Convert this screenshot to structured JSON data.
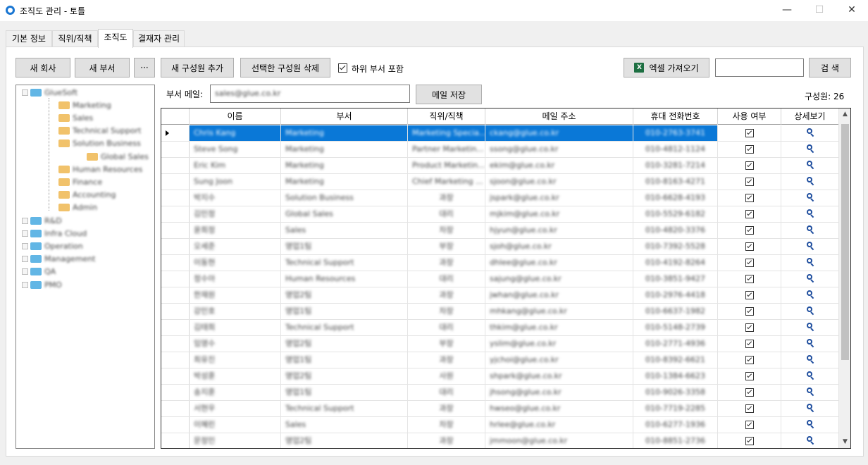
{
  "window": {
    "title": "조직도 관리 - 토틀",
    "minimize_glyph": "—",
    "maximize_glyph": "☐",
    "close_glyph": "✕"
  },
  "tabs": [
    {
      "label": "기본 정보"
    },
    {
      "label": "직위/직책"
    },
    {
      "label": "조직도"
    },
    {
      "label": "결재자 관리"
    }
  ],
  "active_tab": "조직도",
  "toolbar": {
    "new_company": "새 회사",
    "new_department": "새 부서",
    "more": "···",
    "add_member": "새 구성원 추가",
    "delete_selected": "선택한 구성원 삭제",
    "include_subdepartments": "하위 부서 포함",
    "include_subdepartments_checked": true,
    "excel_import": "엑셀 가져오기",
    "excel_icon_text": "X",
    "search_value": "",
    "search_button": "검 색"
  },
  "department_mail": {
    "label": "부서 메일:",
    "value": "sales@glue.co.kr",
    "save_button": "메일 저장"
  },
  "member_count_label": "구성원: 26",
  "tree": [
    {
      "label": "GlueSoft",
      "level": 0
    },
    {
      "label": "Marketing",
      "level": 1
    },
    {
      "label": "Sales",
      "level": 1
    },
    {
      "label": "Technical Support",
      "level": 1
    },
    {
      "label": "Solution Business",
      "level": 1
    },
    {
      "label": "Global Sales",
      "level": 2
    },
    {
      "label": "Human Resources",
      "level": 1
    },
    {
      "label": "Finance",
      "level": 1
    },
    {
      "label": "Accounting",
      "level": 1
    },
    {
      "label": "Admin",
      "level": 1
    },
    {
      "label": "R&D",
      "level": 0
    },
    {
      "label": "Infra Cloud",
      "level": 0
    },
    {
      "label": "Operation",
      "level": 0
    },
    {
      "label": "Management",
      "level": 0
    },
    {
      "label": "QA",
      "level": 0
    },
    {
      "label": "PMO",
      "level": 0
    }
  ],
  "grid": {
    "columns": [
      "이름",
      "부서",
      "직위/직책",
      "메일 주소",
      "휴대 전화번호",
      "사용 여부",
      "상세보기"
    ],
    "rows": [
      {
        "name": "Chris Kang",
        "dept": "Marketing",
        "position": "Marketing Specia...",
        "email": "ckang@glue.co.kr",
        "phone": "010-2763-3741",
        "active": true,
        "selected": true
      },
      {
        "name": "Steve Song",
        "dept": "Marketing",
        "position": "Partner Marketin...",
        "email": "ssong@glue.co.kr",
        "phone": "010-4812-1124",
        "active": true
      },
      {
        "name": "Eric Kim",
        "dept": "Marketing",
        "position": "Product Marketin...",
        "email": "ekim@glue.co.kr",
        "phone": "010-3281-7214",
        "active": true
      },
      {
        "name": "Sung Joon",
        "dept": "Marketing",
        "position": "Chief Marketing ...",
        "email": "sjoon@glue.co.kr",
        "phone": "010-8163-4271",
        "active": true
      },
      {
        "name": "박지수",
        "dept": "Solution Business",
        "position": "과장",
        "email": "jspark@glue.co.kr",
        "phone": "010-6628-4193",
        "active": true
      },
      {
        "name": "김민정",
        "dept": "Global Sales",
        "position": "대리",
        "email": "mjkim@glue.co.kr",
        "phone": "010-5529-6182",
        "active": true
      },
      {
        "name": "윤희정",
        "dept": "Sales",
        "position": "차장",
        "email": "hjyun@glue.co.kr",
        "phone": "010-4820-3376",
        "active": true
      },
      {
        "name": "오세준",
        "dept": "영업1팀",
        "position": "부장",
        "email": "sjoh@glue.co.kr",
        "phone": "010-7392-5528",
        "active": true
      },
      {
        "name": "이동현",
        "dept": "Technical Support",
        "position": "과장",
        "email": "dhlee@glue.co.kr",
        "phone": "010-4192-8264",
        "active": true
      },
      {
        "name": "정수아",
        "dept": "Human Resources",
        "position": "대리",
        "email": "sajung@glue.co.kr",
        "phone": "010-3851-9427",
        "active": true
      },
      {
        "name": "한재원",
        "dept": "영업2팀",
        "position": "과장",
        "email": "jwhan@glue.co.kr",
        "phone": "010-2976-4418",
        "active": true
      },
      {
        "name": "강민호",
        "dept": "영업1팀",
        "position": "차장",
        "email": "mhkang@glue.co.kr",
        "phone": "010-6637-1982",
        "active": true
      },
      {
        "name": "김태희",
        "dept": "Technical Support",
        "position": "대리",
        "email": "thkim@glue.co.kr",
        "phone": "010-5148-2739",
        "active": true
      },
      {
        "name": "임영수",
        "dept": "영업2팀",
        "position": "부장",
        "email": "yslim@glue.co.kr",
        "phone": "010-2771-4936",
        "active": true
      },
      {
        "name": "최유진",
        "dept": "영업1팀",
        "position": "과장",
        "email": "yjchoi@glue.co.kr",
        "phone": "010-8392-6621",
        "active": true
      },
      {
        "name": "박성훈",
        "dept": "영업2팀",
        "position": "사원",
        "email": "shpark@glue.co.kr",
        "phone": "010-1384-6623",
        "active": true
      },
      {
        "name": "송지훈",
        "dept": "영업1팀",
        "position": "대리",
        "email": "jhsong@glue.co.kr",
        "phone": "010-9026-3358",
        "active": true
      },
      {
        "name": "서현우",
        "dept": "Technical Support",
        "position": "과장",
        "email": "hwseo@glue.co.kr",
        "phone": "010-7719-2285",
        "active": true
      },
      {
        "name": "이혜린",
        "dept": "Sales",
        "position": "차장",
        "email": "hrlee@glue.co.kr",
        "phone": "010-6277-1936",
        "active": true
      },
      {
        "name": "문정민",
        "dept": "영업2팀",
        "position": "과장",
        "email": "jmmoon@glue.co.kr",
        "phone": "010-8851-2736",
        "active": true
      }
    ]
  }
}
